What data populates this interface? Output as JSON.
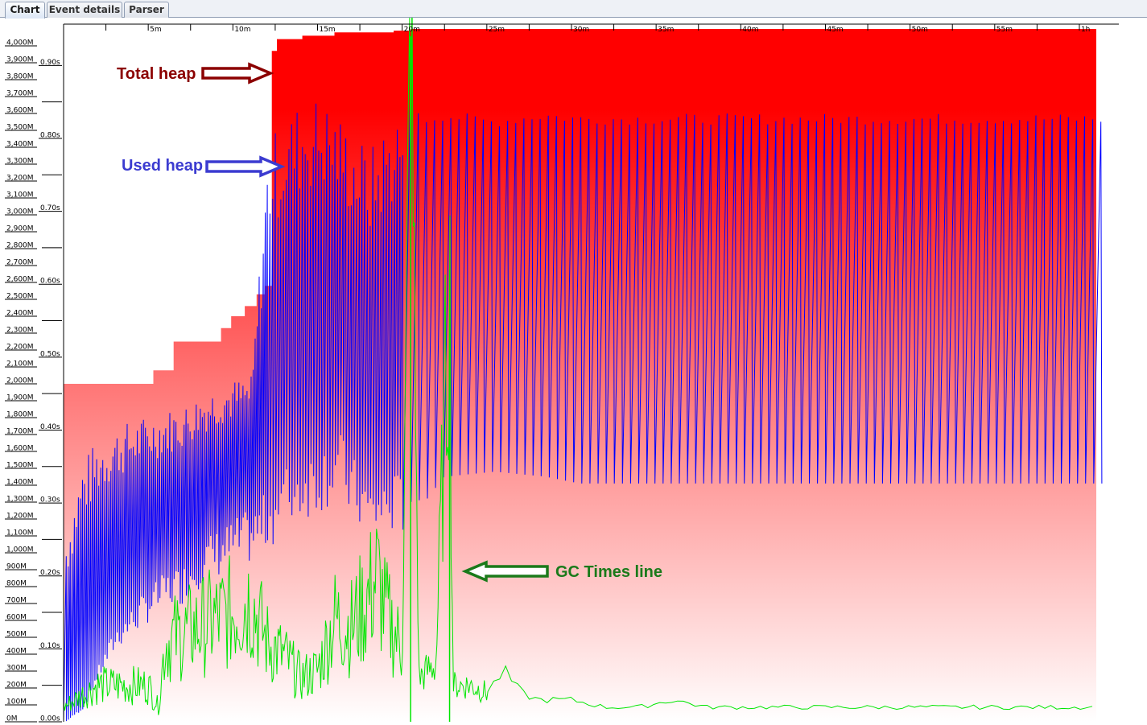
{
  "tabs": [
    {
      "label": "Chart",
      "active": true
    },
    {
      "label": "Event details",
      "active": false
    },
    {
      "label": "Parser",
      "active": false
    }
  ],
  "annotations": {
    "total_heap": "Total heap",
    "used_heap": "Used heap",
    "gc_times": "GC Times line"
  },
  "colors": {
    "total_heap": "#ff0000",
    "used_heap": "#0000ff",
    "gc_times": "#00e600",
    "total_heap_label": "#8b0000",
    "used_heap_label": "#3b3bd0",
    "gc_times_label": "#1a7a1a"
  },
  "chart_data": {
    "type": "area",
    "x_unit": "minutes",
    "xlim": [
      0,
      61
    ],
    "x_ticks": [
      {
        "label": "5m",
        "value": 5
      },
      {
        "label": "10m",
        "value": 10
      },
      {
        "label": "15m",
        "value": 15
      },
      {
        "label": "20m",
        "value": 20
      },
      {
        "label": "25m",
        "value": 25
      },
      {
        "label": "30m",
        "value": 30
      },
      {
        "label": "35m",
        "value": 35
      },
      {
        "label": "40m",
        "value": 40
      },
      {
        "label": "45m",
        "value": 45
      },
      {
        "label": "50m",
        "value": 50
      },
      {
        "label": "55m",
        "value": 55
      },
      {
        "label": "1h",
        "value": 60
      }
    ],
    "y_heap_ticks": [
      "0M",
      "100M",
      "200M",
      "300M",
      "400M",
      "500M",
      "600M",
      "700M",
      "800M",
      "900M",
      "1,000M",
      "1,100M",
      "1,200M",
      "1,300M",
      "1,400M",
      "1,500M",
      "1,600M",
      "1,700M",
      "1,800M",
      "1,900M",
      "2,000M",
      "2,100M",
      "2,200M",
      "2,300M",
      "2,400M",
      "2,500M",
      "2,600M",
      "2,700M",
      "2,800M",
      "2,900M",
      "3,000M",
      "3,100M",
      "3,200M",
      "3,300M",
      "3,400M",
      "3,500M",
      "3,600M",
      "3,700M",
      "3,800M",
      "3,900M",
      "4,000M"
    ],
    "y_heap_lim": [
      0,
      4100
    ],
    "y_gc_ticks": [
      "0.00s",
      "0.10s",
      "0.20s",
      "0.30s",
      "0.40s",
      "0.50s",
      "0.60s",
      "0.70s",
      "0.80s",
      "0.90s"
    ],
    "y_gc_lim": [
      0,
      0.95
    ],
    "series": [
      {
        "name": "Total heap",
        "unit": "MB",
        "x": [
          0,
          5.3,
          5.3,
          6.5,
          6.5,
          9.3,
          9.3,
          9.9,
          9.9,
          10.7,
          10.7,
          11.4,
          11.4,
          11.9,
          11.9,
          12.3,
          12.3,
          12.6,
          12.6,
          14.1,
          14.1,
          16.0,
          16.0,
          19.5,
          19.5,
          20.5,
          20.5,
          61
        ],
        "values": [
          2000,
          2000,
          2080,
          2080,
          2250,
          2250,
          2330,
          2330,
          2400,
          2400,
          2460,
          2460,
          2530,
          2530,
          2580,
          2580,
          3970,
          3970,
          4040,
          4040,
          4060,
          4060,
          4080,
          4080,
          4090,
          4090,
          4100,
          4100
        ]
      },
      {
        "name": "Used heap",
        "unit": "MB",
        "envelope": {
          "x": [
            0,
            1,
            2,
            3,
            4,
            5,
            6,
            7,
            8,
            9,
            10,
            11,
            12,
            13,
            14,
            15,
            16,
            17,
            18,
            19,
            20,
            21,
            22,
            25,
            28,
            30,
            61
          ],
          "peak": [
            1100,
            1550,
            1690,
            1750,
            1790,
            1820,
            1850,
            1880,
            1950,
            2000,
            2030,
            2050,
            3450,
            3600,
            3700,
            3720,
            3620,
            3500,
            3400,
            3580,
            3700,
            3600,
            3620,
            3580,
            3620,
            3600,
            3600
          ],
          "trough": [
            0,
            80,
            300,
            500,
            600,
            700,
            780,
            820,
            940,
            1000,
            1050,
            1100,
            1200,
            1330,
            1400,
            1450,
            1530,
            1360,
            1240,
            1280,
            1300,
            1320,
            1450,
            1480,
            1450,
            1410,
            1410
          ]
        }
      },
      {
        "name": "GC Times",
        "unit": "seconds",
        "x": [
          0,
          2,
          5,
          5.6,
          6,
          7,
          8,
          9,
          10,
          11,
          12,
          13,
          14,
          15,
          16,
          17,
          18,
          18.5,
          19,
          20,
          20.5,
          21,
          22,
          22.8,
          23,
          24,
          25,
          26,
          27,
          28,
          29,
          30,
          32,
          34,
          36,
          38,
          40,
          42,
          44,
          46,
          48,
          50,
          52,
          54,
          56,
          58,
          60,
          61
        ],
        "values": [
          0.02,
          0.05,
          0.05,
          0.02,
          0.11,
          0.12,
          0.13,
          0.14,
          0.15,
          0.17,
          0.11,
          0.09,
          0.06,
          0.07,
          0.14,
          0.13,
          0.17,
          0.2,
          0.15,
          0.1,
          0.94,
          0.06,
          0.08,
          0.62,
          0.05,
          0.05,
          0.04,
          0.07,
          0.04,
          0.03,
          0.03,
          0.03,
          0.02,
          0.02,
          0.03,
          0.02,
          0.02,
          0.02,
          0.02,
          0.02,
          0.02,
          0.02,
          0.02,
          0.02,
          0.02,
          0.02,
          0.02,
          0.02
        ]
      }
    ],
    "grid": false,
    "legend": "none"
  }
}
